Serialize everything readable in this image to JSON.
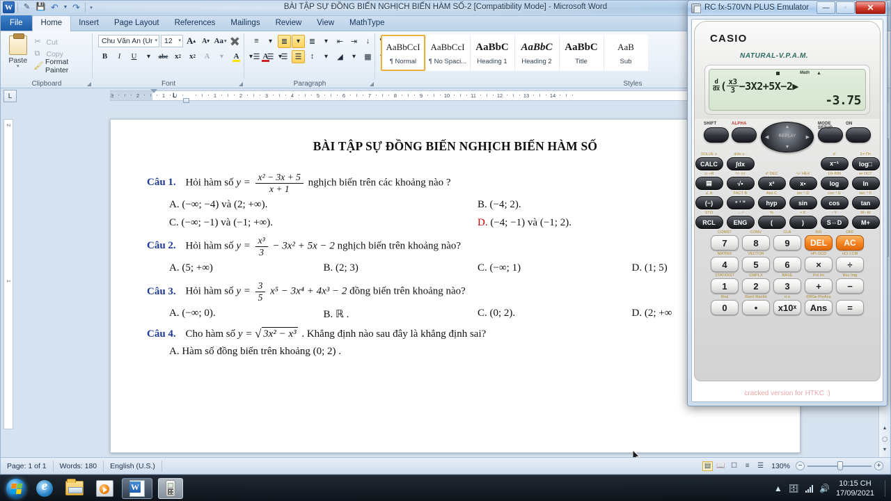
{
  "word": {
    "title": "BÀI TẬP SỰ ĐỒNG BIẾN NGHỊCH BIẾN HÀM SỐ-2 [Compatibility Mode]  -  Microsoft Word",
    "quick_access": {
      "app_icon": "word-icon",
      "customize_icon": "customize-quick-access-icon",
      "save_label": "save-icon",
      "undo_label": "undo-icon",
      "redo_label": "redo-icon"
    },
    "tabs": [
      {
        "label": "File",
        "state": "file"
      },
      {
        "label": "Home",
        "state": "active"
      },
      {
        "label": "Insert",
        "state": "normal"
      },
      {
        "label": "Page Layout",
        "state": "normal"
      },
      {
        "label": "References",
        "state": "normal"
      },
      {
        "label": "Mailings",
        "state": "normal"
      },
      {
        "label": "Review",
        "state": "normal"
      },
      {
        "label": "View",
        "state": "normal"
      },
      {
        "label": "MathType",
        "state": "normal"
      }
    ],
    "ribbon": {
      "clipboard": {
        "group_label": "Clipboard",
        "paste_label": "Paste",
        "cut_label": "Cut",
        "copy_label": "Copy",
        "format_painter_label": "Format Painter"
      },
      "font": {
        "group_label": "Font",
        "font_name": "Chu Văn An (Ur",
        "font_size": "12",
        "grow_label": "A",
        "shrink_label": "A",
        "change_case_label": "Aa",
        "clear_formatting_label": "clear-formatting-icon",
        "bold_label": "B",
        "italic_label": "I",
        "underline_label": "U",
        "strikethrough_label": "abc",
        "subscript_label": "x",
        "superscript_label": "x",
        "text_effects_label": "A",
        "highlight_label": "A",
        "font_color_label": "A"
      },
      "paragraph": {
        "group_label": "Paragraph",
        "bullets_label": "bullets-icon",
        "numbering_label": "numbering-icon",
        "multilevel_label": "multilevel-list-icon",
        "decrease_indent_label": "decrease-indent-icon",
        "increase_indent_label": "increase-indent-icon",
        "sort_label": "sort-icon",
        "show_marks_label": "¶",
        "align_left_label": "align-left-icon",
        "align_center_label": "align-center-icon",
        "align_right_label": "align-right-icon",
        "justify_label": "justify-icon",
        "line_spacing_label": "line-spacing-icon",
        "shading_label": "shading-icon",
        "borders_label": "borders-icon"
      },
      "styles": {
        "group_label": "Styles",
        "items": [
          {
            "preview": "AaBbCcI",
            "name": "¶ Normal",
            "selected": true,
            "kind": "normal"
          },
          {
            "preview": "AaBbCcI",
            "name": "¶ No Spaci...",
            "selected": false,
            "kind": "normal"
          },
          {
            "preview": "AaBbC",
            "name": "Heading 1",
            "selected": false,
            "kind": "h1"
          },
          {
            "preview": "AaBbC",
            "name": "Heading 2",
            "selected": false,
            "kind": "h2"
          },
          {
            "preview": "AaBbC",
            "name": "Title",
            "selected": false,
            "kind": "ti"
          },
          {
            "preview": "AaB",
            "name": "Sub",
            "selected": false,
            "kind": "normal"
          }
        ]
      }
    },
    "ruler": {
      "tab_selector": "L",
      "left_numbers": [
        "3",
        "2",
        "1"
      ],
      "right_numbers": [
        "1",
        "2",
        "3",
        "4",
        "5",
        "6",
        "7",
        "8",
        "9",
        "10",
        "11",
        "12",
        "13",
        "14"
      ]
    },
    "document": {
      "title": "BÀI TẬP SỰ ĐỒNG BIẾN NGHỊCH BIẾN HÀM SỐ",
      "questions": [
        {
          "label": "Câu 1.",
          "stem_before": "Hỏi hàm số",
          "formula": {
            "lhs": "y =",
            "num": "x² − 3x + 5",
            "den": "x + 1"
          },
          "stem_after": "nghịch biến trên các khoảng nào ?",
          "options_layout": "two",
          "options": [
            {
              "letter": "A.",
              "text": "(−∞; −4) và (2; +∞).",
              "red": false
            },
            {
              "letter": "B.",
              "text": "(−4; 2).",
              "red": false
            },
            {
              "letter": "C.",
              "text": "(−∞; −1) và (−1; +∞).",
              "red": false
            },
            {
              "letter": "D.",
              "text": "(−4; −1) và (−1; 2).",
              "red": true
            }
          ]
        },
        {
          "label": "Câu 2.",
          "stem_before": "Hỏi hàm số",
          "formula": {
            "lhs": "y =",
            "num": "x³",
            "den": "3",
            "tail": "− 3x² + 5x − 2"
          },
          "stem_after": "nghịch biến trên khoảng nào?",
          "options_layout": "four",
          "options": [
            {
              "letter": "A.",
              "text": "(5; +∞)",
              "red": false
            },
            {
              "letter": "B.",
              "text": "(2; 3)",
              "red": false
            },
            {
              "letter": "C.",
              "text": "(−∞; 1)",
              "red": false
            },
            {
              "letter": "D.",
              "text": "(1; 5)",
              "red": false
            }
          ]
        },
        {
          "label": "Câu 3.",
          "stem_before": "Hỏi hàm số",
          "formula": {
            "lhs": "y =",
            "num": "3",
            "den": "5",
            "tail": "x⁵ − 3x⁴ + 4x³ − 2"
          },
          "stem_after": "đồng biến trên khoảng nào?",
          "options_layout": "four",
          "options": [
            {
              "letter": "A.",
              "text": "(−∞; 0).",
              "red": false
            },
            {
              "letter": "B.",
              "text": "ℝ .",
              "red": false
            },
            {
              "letter": "C.",
              "text": "(0; 2).",
              "red": false
            },
            {
              "letter": "D.",
              "text": "(2; +∞",
              "red": false
            }
          ]
        },
        {
          "label": "Câu 4.",
          "stem_before": "Cho hàm số",
          "formula": {
            "lhs": "y =",
            "sqrt": "3x² − x³"
          },
          "stem_after": ". Khẳng định nào sau đây là khẳng định sai?",
          "options_layout": "single",
          "options": [
            {
              "letter": "A.",
              "text": "Hàm số đồng biến trên khoảng (0; 2) .",
              "red": false
            }
          ]
        }
      ]
    },
    "status_bar": {
      "page": "Page: 1 of 1",
      "words": "Words: 180",
      "language": "English (U.S.)",
      "zoom": "130%",
      "view_buttons": [
        "print-layout-icon",
        "full-screen-reading-icon",
        "web-layout-icon",
        "outline-icon",
        "draft-icon"
      ],
      "zoom_out": "−",
      "zoom_in": "+"
    }
  },
  "calculator": {
    "window_title": "RC fx-570VN PLUS Emulator",
    "window_buttons": {
      "minimize": "—",
      "maximize": "▫",
      "close": "✕"
    },
    "brand": "CASIO",
    "sub_brand": "NATURAL-V.P.A.M.",
    "display": {
      "indicator_math": "Math",
      "indicator_arrow": "▲",
      "expression_prefix": "d",
      "expression_denom": "dx",
      "expression_open": "(",
      "frac_num": "x3",
      "frac_den": "3",
      "expression_tail": "−3X2+5X−2",
      "expression_close": "▶",
      "result": "-3.75"
    },
    "top_keys": [
      {
        "label": "SHIFT",
        "color": "dark"
      },
      {
        "label": "ALPHA",
        "color": "red"
      },
      {
        "label": "MODE SETUP",
        "color": "dark"
      },
      {
        "label": "ON",
        "color": "dark"
      }
    ],
    "replay_label": "REPLAY",
    "key_rows": [
      [
        {
          "shift": "SOLVE ≡",
          "main": "CALC",
          "type": "dark"
        },
        {
          "shift": "d/dx ≡ :",
          "main": "∫dx",
          "type": "dark"
        },
        {
          "shift": "",
          "main": "",
          "type": "spacer"
        },
        {
          "shift": "",
          "main": "",
          "type": "spacer"
        },
        {
          "shift": "x!",
          "main": "x⁻¹",
          "type": "dark"
        },
        {
          "shift": "Σ= Π=",
          "main": "log□",
          "type": "dark"
        }
      ],
      [
        {
          "shift": "▭ ÷R",
          "main": "▤",
          "type": "dark"
        },
        {
          "shift": "³√▫ (▪)",
          "main": "√▪",
          "type": "dark"
        },
        {
          "shift": "x³ DEC",
          "main": "x²",
          "type": "dark"
        },
        {
          "shift": "ˣ√▫ HEX",
          "main": "x▪",
          "type": "dark"
        },
        {
          "shift": "10▪ BIN",
          "main": "log",
          "type": "dark"
        },
        {
          "shift": "e▪ OCT",
          "main": "ln",
          "type": "dark"
        }
      ],
      [
        {
          "shift": "∠ A",
          "main": "(−)",
          "type": "dark"
        },
        {
          "shift": "FACT B",
          "main": "° ’ ”",
          "type": "dark"
        },
        {
          "shift": "Abs C",
          "main": "hyp",
          "type": "dark"
        },
        {
          "shift": "sin⁻¹ D",
          "main": "sin",
          "type": "dark"
        },
        {
          "shift": "cos⁻¹ E",
          "main": "cos",
          "type": "dark"
        },
        {
          "shift": "tan⁻¹ F",
          "main": "tan",
          "type": "dark"
        }
      ],
      [
        {
          "shift": "STO",
          "main": "RCL",
          "type": "dark"
        },
        {
          "shift": "←  /",
          "main": "ENG",
          "type": "dark"
        },
        {
          "shift": "%",
          "main": "(",
          "type": "dark"
        },
        {
          "shift": "▪  X",
          "main": ")",
          "type": "dark"
        },
        {
          "shift": "▫ Y",
          "main": "S⇔D",
          "type": "dark"
        },
        {
          "shift": "M− M",
          "main": "M+",
          "type": "dark"
        }
      ],
      [
        {
          "shift": "CONST",
          "main": "7",
          "type": "big"
        },
        {
          "shift": "CONV",
          "main": "8",
          "type": "big"
        },
        {
          "shift": "CLR",
          "main": "9",
          "type": "big"
        },
        {
          "shift": "INS",
          "main": "DEL",
          "type": "orange"
        },
        {
          "shift": "OFF",
          "main": "AC",
          "type": "orange"
        }
      ],
      [
        {
          "shift": "MATRIX",
          "main": "4",
          "type": "big"
        },
        {
          "shift": "VECTOR",
          "main": "5",
          "type": "big"
        },
        {
          "shift": "",
          "main": "6",
          "type": "big"
        },
        {
          "shift": "nPr GCD",
          "main": "×",
          "type": "big"
        },
        {
          "shift": "nCr LCM",
          "main": "÷",
          "type": "big"
        }
      ],
      [
        {
          "shift": "STAT/DIST",
          "main": "1",
          "type": "big"
        },
        {
          "shift": "CMPLX",
          "main": "2",
          "type": "big"
        },
        {
          "shift": "BASE",
          "main": "3",
          "type": "big"
        },
        {
          "shift": "Pol Int",
          "main": "+",
          "type": "big"
        },
        {
          "shift": "Rec Intg",
          "main": "−",
          "type": "big"
        }
      ],
      [
        {
          "shift": "Rnd",
          "main": "0",
          "type": "big"
        },
        {
          "shift": "Ran# RanInt",
          "main": "•",
          "type": "big"
        },
        {
          "shift": "π e",
          "main": "x10ˣ",
          "type": "big"
        },
        {
          "shift": "DRG▸ PreAns",
          "main": "Ans",
          "type": "big"
        },
        {
          "shift": "",
          "main": "=",
          "type": "big"
        }
      ]
    ],
    "footer_note": "cracked version for HTKC :)"
  },
  "taskbar": {
    "start_label": "start-orb",
    "pinned": [
      {
        "name": "internet-explorer-icon"
      },
      {
        "name": "windows-explorer-icon"
      },
      {
        "name": "media-player-icon"
      }
    ],
    "apps": [
      {
        "name": "word-taskbar-button",
        "active": true
      },
      {
        "name": "calculator-taskbar-button",
        "active": false
      }
    ],
    "tray": {
      "show_hidden": "▲",
      "action_center": "action-center-icon",
      "network": "network-icon",
      "volume": "volume-icon",
      "time": "10:15 CH",
      "date": "17/09/2021"
    }
  }
}
